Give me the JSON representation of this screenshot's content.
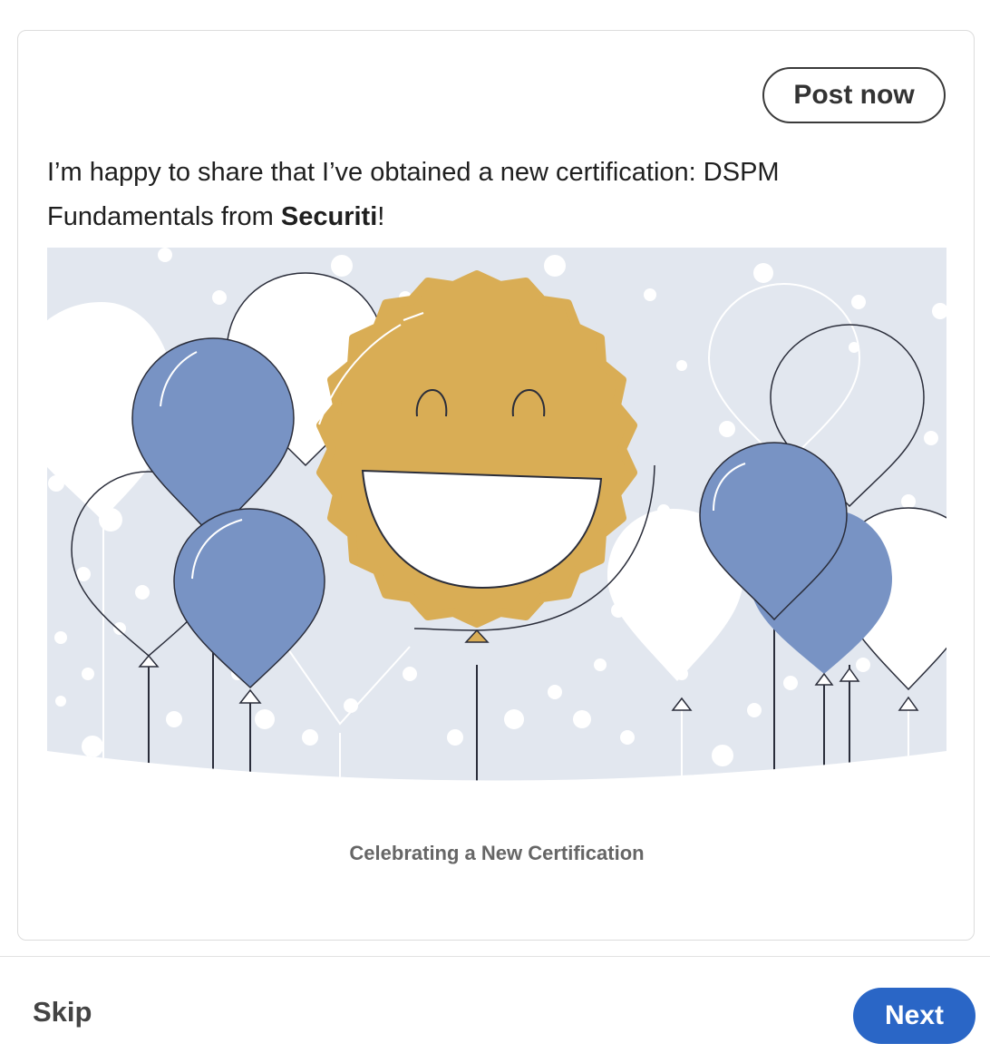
{
  "actions": {
    "post_now_label": "Post now"
  },
  "post": {
    "text_prefix": "I’m happy to share that I’ve obtained a new certification: DSPM Fundamentals from ",
    "organization": "Securiti",
    "text_suffix": "!"
  },
  "illustration": {
    "caption": "Celebrating a New Certification",
    "colors": {
      "background": "#e2e7ef",
      "balloon_blue": "#7893c4",
      "badge_gold": "#d9ad55",
      "outline": "#2a2d3a"
    }
  },
  "footer": {
    "skip_label": "Skip",
    "next_label": "Next"
  },
  "colors": {
    "primary": "#2a66c6",
    "text": "#1f1f1f"
  }
}
